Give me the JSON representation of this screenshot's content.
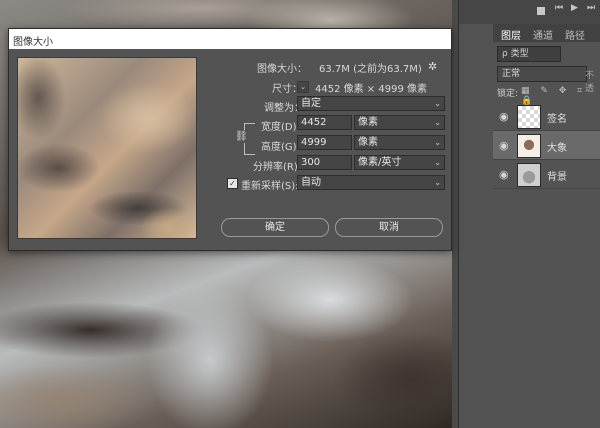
{
  "dialog": {
    "title": "图像大小",
    "image_size_label": "图像大小：",
    "image_size_value": "63.7M (之前为63.7M)",
    "dimensions_label": "尺寸：",
    "dimensions_value": "4452 像素 × 4999 像素",
    "fit_to_label": "调整为：",
    "fit_to_value": "自定",
    "width_label": "宽度(D):",
    "width_value": "4452",
    "width_unit": "像素",
    "height_label": "高度(G):",
    "height_value": "4999",
    "height_unit": "像素",
    "resolution_label": "分辨率(R):",
    "resolution_value": "300",
    "resolution_unit": "像素/英寸",
    "resample_label": "重新采样(S):",
    "resample_checked": "✓",
    "resample_value": "自动",
    "ok_label": "确定",
    "cancel_label": "取消"
  },
  "layers_panel": {
    "tabs": [
      "图层",
      "通道",
      "路径"
    ],
    "active_tab": 0,
    "filter_label": "ρ 类型",
    "blend_mode": "正常",
    "opacity_label": "不透",
    "lock_label": "锁定:",
    "lock_icons": "▦ ✎ ✥ ⌗ 🔒",
    "layers": [
      {
        "name": "签名",
        "visible_icon": "eye-icon",
        "selected": false
      },
      {
        "name": "大象",
        "visible_icon": "eye-icon",
        "selected": true
      },
      {
        "name": "背景",
        "visible_icon": "eye-icon",
        "selected": false
      }
    ]
  },
  "icons": {
    "gear": "gear-icon",
    "link": "chain-link-icon",
    "dropdown": "chevron-down-icon"
  },
  "colors": {
    "dialog_bg": "#535353",
    "panel_bg": "#535353",
    "selected_layer": "#6a6a6a",
    "titlebar": "#ffffff"
  }
}
